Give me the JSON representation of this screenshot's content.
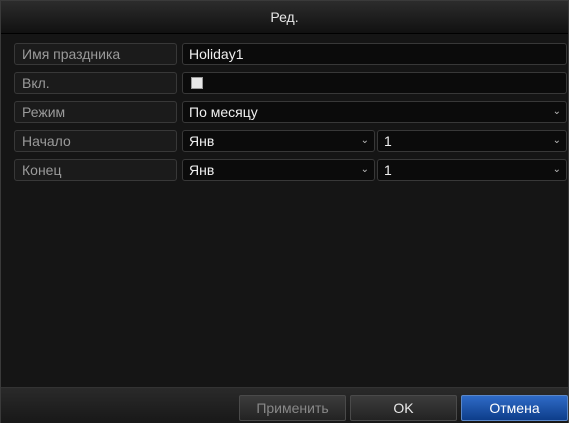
{
  "dialog": {
    "title": "Ред."
  },
  "fields": {
    "holiday_name": {
      "label": "Имя праздника",
      "value": "Holiday1"
    },
    "enabled": {
      "label": "Вкл.",
      "checked": false
    },
    "mode": {
      "label": "Режим",
      "value": "По месяцу"
    },
    "start": {
      "label": "Начало",
      "month": "Янв",
      "day": "1"
    },
    "end": {
      "label": "Конец",
      "month": "Янв",
      "day": "1"
    }
  },
  "icons": {
    "dropdown": "chevron-down-icon",
    "dropdown_glyph": "⌄"
  },
  "buttons": {
    "apply": "Применить",
    "ok": "OK",
    "cancel": "Отмена"
  },
  "colors": {
    "accent": "#1f5fbf",
    "background": "#151515",
    "text": "#f0f0f0",
    "label_text": "#9a9a9a"
  }
}
